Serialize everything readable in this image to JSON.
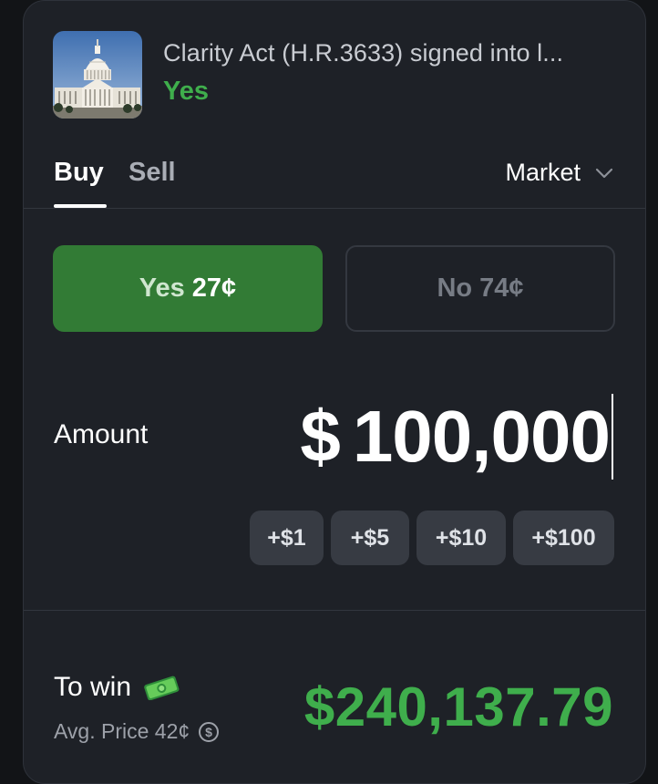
{
  "market": {
    "title": "Clarity Act (H.R.3633) signed into l...",
    "outcome": "Yes",
    "thumbnail_icon": "capitol-building-image"
  },
  "tabs": {
    "buy": "Buy",
    "sell": "Sell",
    "active": "Buy"
  },
  "order_type": {
    "selected": "Market",
    "icon": "chevron-down-icon"
  },
  "outcomes": {
    "yes": {
      "label": "Yes",
      "price": "27¢",
      "selected": true
    },
    "no": {
      "label": "No",
      "price": "74¢",
      "selected": false
    }
  },
  "amount": {
    "label": "Amount",
    "currency": "$",
    "value": "100,000"
  },
  "quick_add": [
    "+$1",
    "+$5",
    "+$10",
    "+$100"
  ],
  "summary": {
    "to_win_label": "To win",
    "to_win_icon": "money-icon",
    "avg_price_label": "Avg. Price 42¢",
    "avg_icon": "dollar-info-icon",
    "payout_currency": "$",
    "payout_value": "240,137.79"
  },
  "colors": {
    "panel": "#1e2127",
    "accent_green": "#3fae4c",
    "yes_button": "#327b35",
    "quick_button": "#373b43"
  }
}
